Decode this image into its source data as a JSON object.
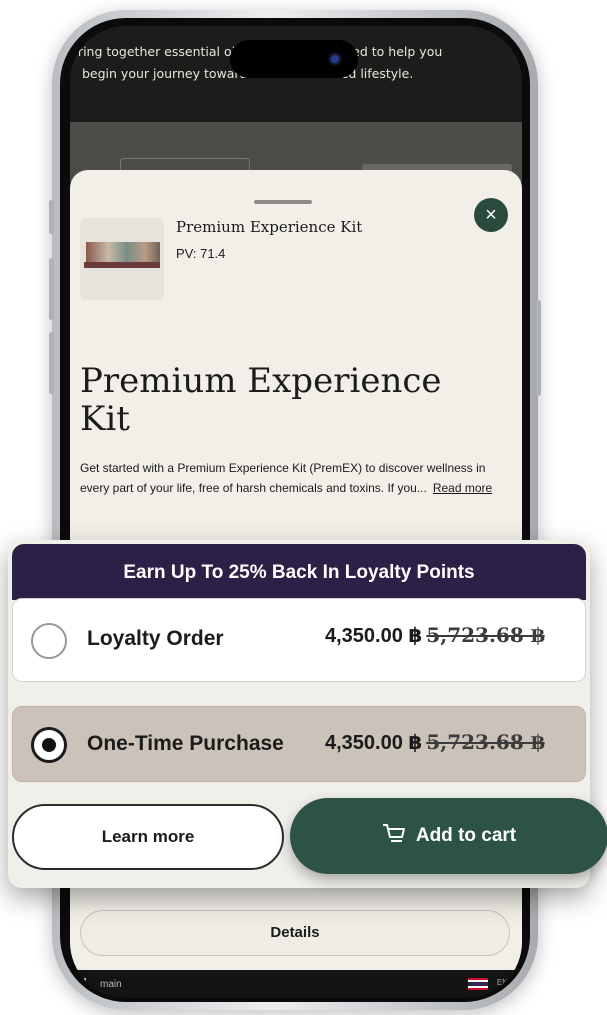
{
  "background_page": {
    "line1": "bring together essential oils and tools designed to help you",
    "line2": "begin your journey toward a more balanced lifestyle."
  },
  "product": {
    "name": "Premium Experience Kit",
    "pv": "PV: 71.4",
    "title": "Premium Experience Kit",
    "description": "Get started with a Premium Experience Kit (PremEX) to discover wellness in every part of your life, free of harsh chemicals and toxins. If you...",
    "read_more": "Read more"
  },
  "overlay": {
    "banner": "Earn Up To 25% Back In Loyalty Points",
    "options": [
      {
        "label": "Loyalty Order",
        "price": "4,350.00 ฿",
        "original_price": "5,723.68 ฿",
        "selected": false
      },
      {
        "label": "One-Time Purchase",
        "price": "4,350.00 ฿",
        "original_price": "5,723.68 ฿",
        "selected": true
      }
    ],
    "learn_more": "Learn more",
    "add_to_cart": "Add to cart"
  },
  "details_button": "Details",
  "bottom_bar": {
    "branch": "main",
    "language": "EN"
  },
  "colors": {
    "banner": "#2d2046",
    "cart_button": "#2d5346",
    "close_button": "#2a4a3e",
    "sheet": "#f2efe8"
  },
  "icons": [
    "close-icon",
    "cart-icon",
    "radio-icon",
    "flag-icon",
    "branch-icon"
  ]
}
